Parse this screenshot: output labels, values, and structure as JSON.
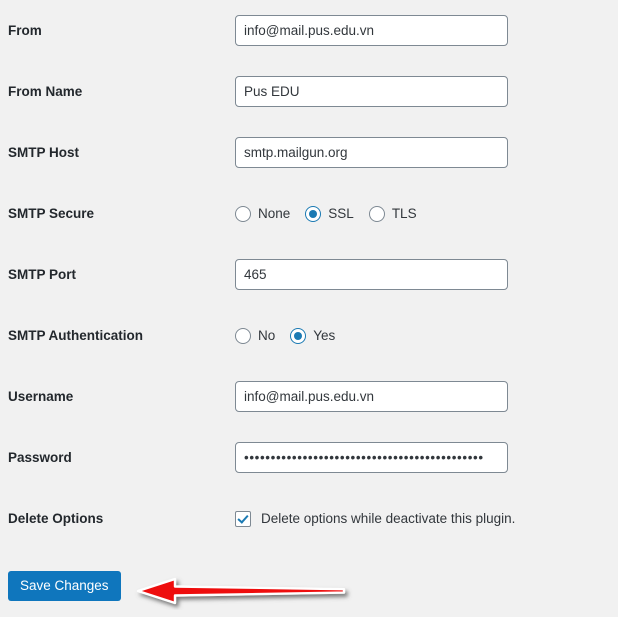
{
  "page": {
    "background_color": "#f1f1f1",
    "label_color": "#23282d",
    "value_color": "#32373c",
    "accent_color": "#1b7ab3",
    "button_color": "#0f76bd",
    "annotation_color": "#ee1111"
  },
  "fields": {
    "from": {
      "label": "From",
      "value": "info@mail.pus.edu.vn",
      "placeholder": ""
    },
    "from_name": {
      "label": "From Name",
      "value": "Pus EDU",
      "placeholder": ""
    },
    "smtp_host": {
      "label": "SMTP Host",
      "value": "smtp.mailgun.org",
      "placeholder": ""
    },
    "smtp_secure": {
      "label": "SMTP Secure",
      "options": [
        {
          "label": "None",
          "checked": false
        },
        {
          "label": "SSL",
          "checked": true
        },
        {
          "label": "TLS",
          "checked": false
        }
      ],
      "selected": "SSL"
    },
    "smtp_port": {
      "label": "SMTP Port",
      "value": "465",
      "placeholder": ""
    },
    "smtp_authentication": {
      "label": "SMTP Authentication",
      "options": [
        {
          "label": "No",
          "checked": false
        },
        {
          "label": "Yes",
          "checked": true
        }
      ],
      "selected": "Yes"
    },
    "username": {
      "label": "Username",
      "value": "info@mail.pus.edu.vn",
      "placeholder": ""
    },
    "password": {
      "label": "Password",
      "value": "•••••••••••••••••••••••••••••••••••••••••••••",
      "placeholder": ""
    },
    "delete_options": {
      "label": "Delete Options",
      "checkbox_label": "Delete options while deactivate this plugin.",
      "checked": true
    }
  },
  "actions": {
    "save_label": "Save Changes"
  },
  "annotation": {
    "icon": "arrow-left-icon",
    "direction": "left",
    "target": "save-changes-button",
    "fill_color": "#ee1111",
    "outline_color": "#ffffff"
  }
}
